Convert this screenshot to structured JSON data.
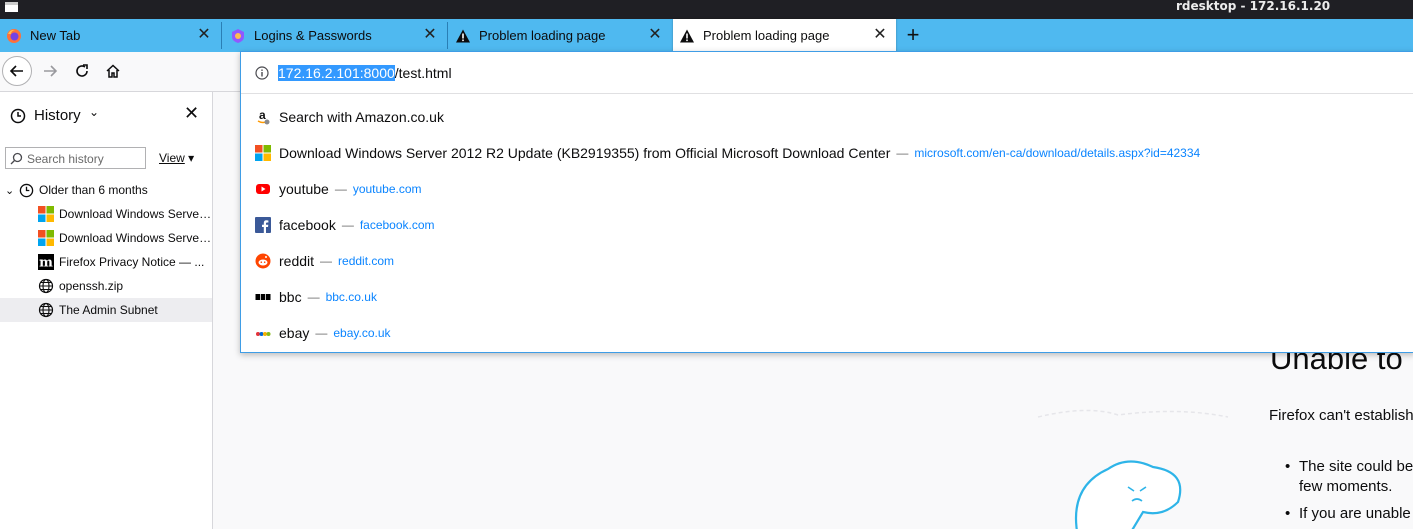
{
  "remote_window": {
    "title": "rdesktop - 172.16.1.20"
  },
  "tabs": [
    {
      "label": "New Tab",
      "icon": "firefox-icon"
    },
    {
      "label": "Logins & Passwords",
      "icon": "lockwise-icon"
    },
    {
      "label": "Problem loading page",
      "icon": "warning-icon"
    },
    {
      "label": "Problem loading page",
      "icon": "warning-icon",
      "active": true
    }
  ],
  "urlbar": {
    "selected_part": "172.16.2.101:8000",
    "rest_part": "/test.html"
  },
  "suggestions": [
    {
      "title": "Search with Amazon.co.uk",
      "url": "",
      "icon": "amazon-icon"
    },
    {
      "title": "Download Windows Server 2012 R2 Update (KB2919355) from Official Microsoft Download Center",
      "url": "microsoft.com/en-ca/download/details.aspx?id=42334",
      "icon": "microsoft-icon"
    },
    {
      "title": "youtube",
      "url": "youtube.com",
      "icon": "youtube-icon"
    },
    {
      "title": "facebook",
      "url": "facebook.com",
      "icon": "facebook-icon"
    },
    {
      "title": "reddit",
      "url": "reddit.com",
      "icon": "reddit-icon"
    },
    {
      "title": "bbc",
      "url": "bbc.co.uk",
      "icon": "bbc-icon"
    },
    {
      "title": "ebay",
      "url": "ebay.co.uk",
      "icon": "ebay-icon"
    }
  ],
  "sidebar": {
    "title": "History",
    "search_placeholder": "Search history",
    "view_label": "View",
    "group_label": "Older than 6 months",
    "items": [
      {
        "label": "Download Windows Server...",
        "icon": "microsoft-icon"
      },
      {
        "label": "Download Windows Server...",
        "icon": "microsoft-icon"
      },
      {
        "label": "Firefox Privacy Notice — ...",
        "icon": "mozilla-icon"
      },
      {
        "label": "openssh.zip",
        "icon": "globe-icon"
      },
      {
        "label": "The Admin Subnet",
        "icon": "globe-icon"
      }
    ]
  },
  "error_page": {
    "title": "Unable to",
    "subtitle": "Firefox can't establish",
    "bullets": [
      "The site could be",
      "few moments.",
      "If you are unable"
    ]
  },
  "colors": {
    "tab_strip": "#4fb9f0",
    "link": "#0a84ff",
    "selection": "#3399ff"
  }
}
